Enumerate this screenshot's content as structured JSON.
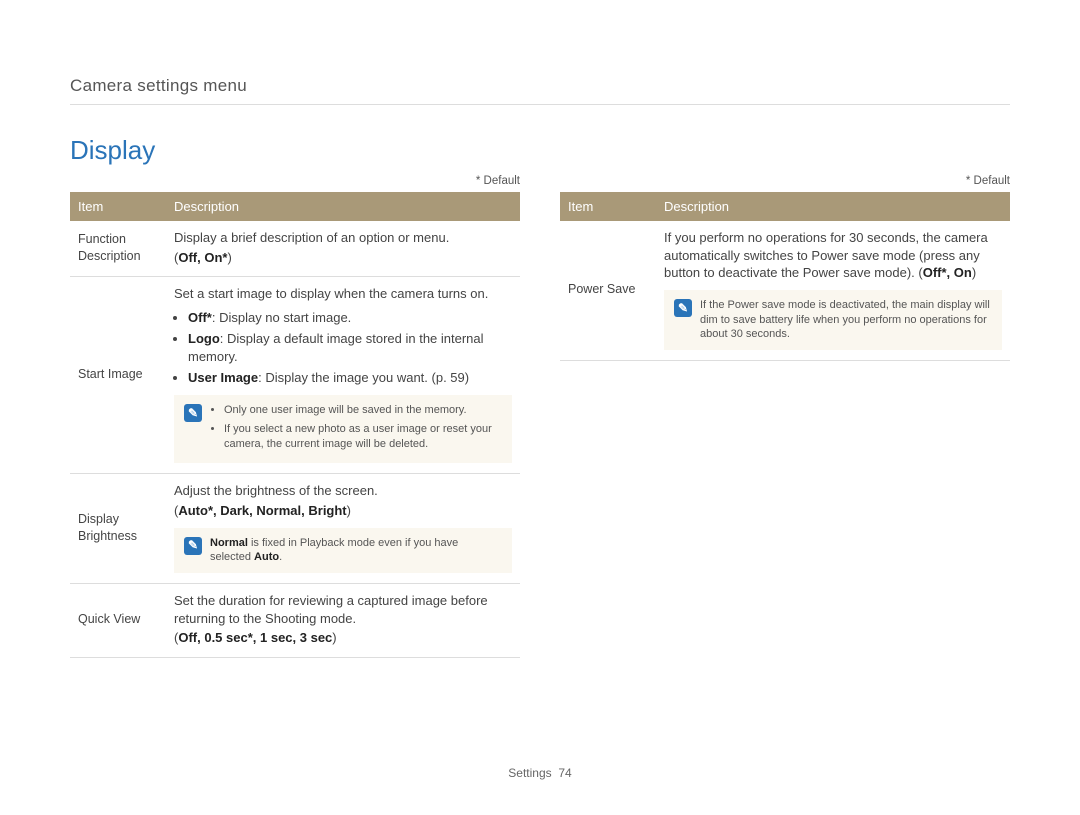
{
  "breadcrumb": "Camera settings menu",
  "section_title": "Display",
  "default_marker": "* Default",
  "headers": {
    "item": "Item",
    "description": "Description"
  },
  "left": {
    "rows": [
      {
        "item": "Function Description",
        "lead": "Display a brief description of an option or menu.",
        "options_prefix": "(",
        "options": "Off, On*",
        "options_suffix": ")"
      },
      {
        "item": "Start Image",
        "lead": "Set a start image to display when the camera turns on.",
        "bullets": [
          {
            "label": "Off*",
            "text": ": Display no start image."
          },
          {
            "label": "Logo",
            "text": ": Display a default image stored in the internal memory."
          },
          {
            "label": "User Image",
            "text": ": Display the image you want. (p. 59)"
          }
        ],
        "note_items": [
          "Only one user image will be saved in the memory.",
          "If you select a new photo as a user image or reset your camera, the current image will be deleted."
        ]
      },
      {
        "item": "Display Brightness",
        "lead": "Adjust the brightness of the screen.",
        "options_prefix": "(",
        "options": "Auto*, Dark, Normal, Bright",
        "options_suffix": ")",
        "note_single_pre": "Normal",
        "note_single_mid": " is fixed in Playback mode even if you have selected ",
        "note_single_post": "Auto",
        "note_single_end": "."
      },
      {
        "item": "Quick View",
        "lead": "Set the duration for reviewing a captured image before returning to the Shooting mode.",
        "options_prefix": "(",
        "options": "Off, 0.5 sec*, 1 sec, 3 sec",
        "options_suffix": ")"
      }
    ]
  },
  "right": {
    "rows": [
      {
        "item": "Power Save",
        "lead": "If you perform no operations for 30 seconds, the camera automatically switches to Power save mode (press any button to deactivate the Power save mode). (",
        "options": "Off*, On",
        "options_suffix": ")",
        "note_single": "If the Power save mode is deactivated, the main display will dim to save battery life when you perform no operations for about 30 seconds."
      }
    ]
  },
  "footer": {
    "label": "Settings",
    "page": "74"
  }
}
